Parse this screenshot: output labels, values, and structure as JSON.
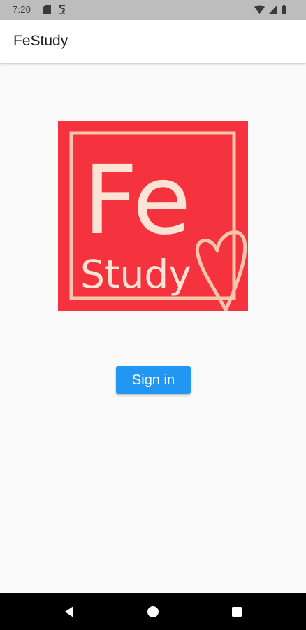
{
  "status_bar": {
    "time": "7:20",
    "icons_left": [
      "sd-card-icon",
      "sim-icon"
    ],
    "icons_right": [
      "wifi-icon",
      "signal-icon",
      "battery-icon"
    ]
  },
  "app_bar": {
    "title": "FeStudy"
  },
  "logo": {
    "text_large": "Fe",
    "text_small": "Study",
    "background_color": "#f5333f",
    "accent_color": "#f9c6ad"
  },
  "sign_in_button": {
    "label": "Sign in",
    "color": "#2196f3"
  },
  "nav_bar": {
    "buttons": [
      "back-icon",
      "home-icon",
      "recents-icon"
    ]
  }
}
